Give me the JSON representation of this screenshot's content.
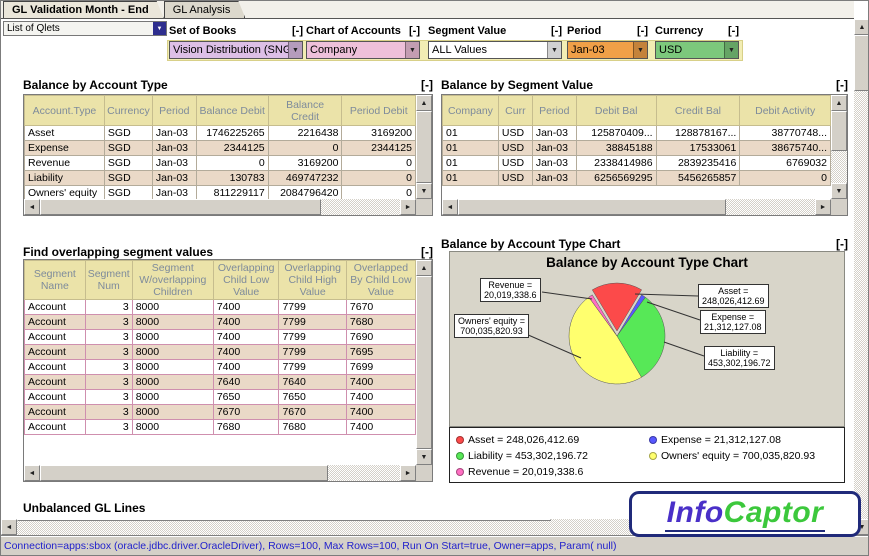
{
  "tabs": [
    {
      "label": "GL Validation Month - End"
    },
    {
      "label": "GL Analysis"
    }
  ],
  "qlet_selector": {
    "value": "List of Qlets"
  },
  "filters": [
    {
      "label": "Set of Books",
      "collapse": "[-]",
      "value": "Vision Distribution (SNG)",
      "color": "#ddbfe6"
    },
    {
      "label": "Chart of Accounts",
      "collapse": "[-]",
      "value": "Company",
      "color": "#eec0da"
    },
    {
      "label": "Segment Value",
      "collapse": "[-]",
      "value": "ALL Values",
      "color": "#ffffff"
    },
    {
      "label": "Period",
      "collapse": "[-]",
      "value": "Jan-03",
      "color": "#f0a048"
    },
    {
      "label": "Currency",
      "collapse": "[-]",
      "value": "USD",
      "color": "#7cc87c"
    }
  ],
  "panels": {
    "balance_by_account_type": {
      "title": "Balance by Account Type",
      "collapse": "[-]",
      "table": {
        "columns": [
          "Account.Type",
          "Currency",
          "Period",
          "Balance Debit",
          "Balance Credit",
          "Period Debit"
        ],
        "rows": [
          [
            "Asset",
            "SGD",
            "Jan-03",
            "1746225265",
            "2216438",
            "3169200"
          ],
          [
            "Expense",
            "SGD",
            "Jan-03",
            "2344125",
            "0",
            "2344125"
          ],
          [
            "Revenue",
            "SGD",
            "Jan-03",
            "0",
            "3169200",
            "0"
          ],
          [
            "Liability",
            "SGD",
            "Jan-03",
            "130783",
            "469747232",
            "0"
          ],
          [
            "Owners' equity",
            "SGD",
            "Jan-03",
            "811229117",
            "2084796420",
            "0"
          ]
        ]
      }
    },
    "balance_by_segment_value": {
      "title": "Balance by Segment Value",
      "collapse": "[-]",
      "table": {
        "columns": [
          "Company",
          "Curr",
          "Period",
          "Debit Bal",
          "Credit Bal",
          "Debit Activity"
        ],
        "rows": [
          [
            "01",
            "USD",
            "Jan-03",
            "125870409...",
            "128878167...",
            "38770748..."
          ],
          [
            "01",
            "USD",
            "Jan-03",
            "38845188",
            "17533061",
            "38675740..."
          ],
          [
            "01",
            "USD",
            "Jan-03",
            "2338414986",
            "2839235416",
            "6769032"
          ],
          [
            "01",
            "USD",
            "Jan-03",
            "6256569295",
            "5456265857",
            "0"
          ]
        ]
      }
    },
    "find_overlapping": {
      "title": "Find overlapping segment values",
      "collapse": "[-]",
      "table": {
        "columns": [
          "Segment Name",
          "Segment Num",
          "Segment W/overlapping Children",
          "Overlapping Child Low Value",
          "Overlapping Child High Value",
          "Overlapped By Child Low Value"
        ],
        "rows": [
          [
            "Account",
            "3",
            "8000",
            "7400",
            "7799",
            "7670"
          ],
          [
            "Account",
            "3",
            "8000",
            "7400",
            "7799",
            "7680"
          ],
          [
            "Account",
            "3",
            "8000",
            "7400",
            "7799",
            "7690"
          ],
          [
            "Account",
            "3",
            "8000",
            "7400",
            "7799",
            "7695"
          ],
          [
            "Account",
            "3",
            "8000",
            "7400",
            "7799",
            "7699"
          ],
          [
            "Account",
            "3",
            "8000",
            "7640",
            "7640",
            "7400"
          ],
          [
            "Account",
            "3",
            "8000",
            "7650",
            "7650",
            "7400"
          ],
          [
            "Account",
            "3",
            "8000",
            "7670",
            "7670",
            "7400"
          ],
          [
            "Account",
            "3",
            "8000",
            "7680",
            "7680",
            "7400"
          ]
        ]
      }
    },
    "chart_panel": {
      "title": "Balance by Account Type Chart",
      "collapse": "[-]"
    },
    "unbalanced_gl_lines": {
      "title": "Unbalanced GL Lines",
      "collapse": "[-]"
    }
  },
  "chart_data": {
    "type": "pie",
    "title": "Balance by Account Type Chart",
    "slices": [
      {
        "label": "Asset",
        "value": 248026412.69,
        "color": "#fc4a4a"
      },
      {
        "label": "Expense",
        "value": 21312127.08,
        "color": "#5858ff"
      },
      {
        "label": "Liability",
        "value": 453302196.72,
        "color": "#57e857"
      },
      {
        "label": "Owners' equity",
        "value": 700035820.93,
        "color": "#ffff6e"
      },
      {
        "label": "Revenue",
        "value": 20019338.6,
        "color": "#ff6ec2"
      }
    ],
    "callouts": [
      {
        "text": "Revenue =\n20,019,338.6"
      },
      {
        "text": "Asset =\n248,026,412.69"
      },
      {
        "text": "Expense =\n21,312,127.08"
      },
      {
        "text": "Owners' equity =\n700,035,820.93"
      },
      {
        "text": "Liability =\n453,302,196.72"
      }
    ],
    "legend": [
      {
        "text": "Asset = 248,026,412.69",
        "color": "#fc4a4a"
      },
      {
        "text": "Expense = 21,312,127.08",
        "color": "#5858ff"
      },
      {
        "text": "Liability = 453,302,196.72",
        "color": "#57e857"
      },
      {
        "text": "Owners' equity = 700,035,820.93",
        "color": "#ffff6e"
      },
      {
        "text": "Revenue = 20,019,338.6",
        "color": "#ff6ec2"
      }
    ]
  },
  "status_bar": {
    "text": "Connection=apps:sbox (oracle.jdbc.driver.OracleDriver), Rows=100, Max Rows=100, Run On Start=true, Owner=apps, Param( null)"
  },
  "logo": {
    "part1": "Info",
    "part2": "Captor",
    "color1": "#4a30c8",
    "color2": "#3cc83c"
  }
}
